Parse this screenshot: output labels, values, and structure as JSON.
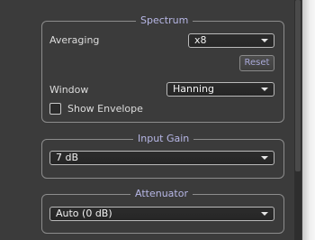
{
  "spectrum": {
    "legend": "Spectrum",
    "averaging_label": "Averaging",
    "averaging_value": "x8",
    "reset_label": "Reset",
    "window_label": "Window",
    "window_value": "Hanning",
    "show_envelope_label": "Show Envelope",
    "show_envelope_checked": false
  },
  "input_gain": {
    "legend": "Input Gain",
    "value": "7 dB"
  },
  "attenuator": {
    "legend": "Attenuator",
    "value": "Auto (0 dB)"
  }
}
